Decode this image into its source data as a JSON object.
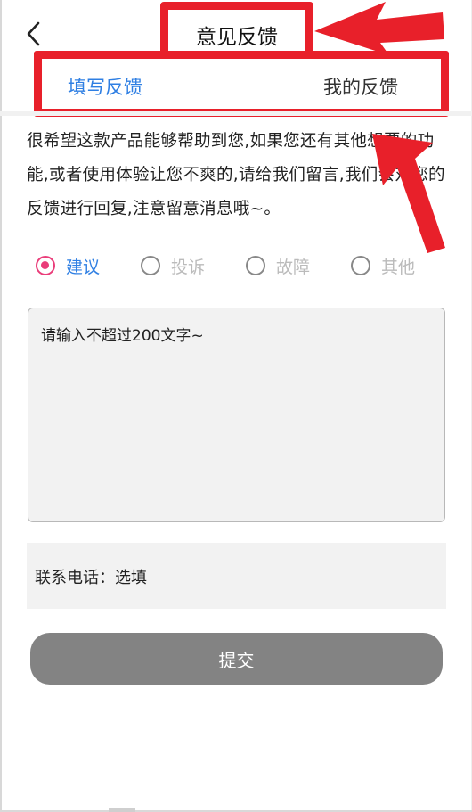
{
  "header": {
    "title": "意见反馈"
  },
  "tabs": [
    {
      "label": "填写反馈",
      "active": true
    },
    {
      "label": "我的反馈",
      "active": false
    }
  ],
  "intro": {
    "text": "很希望这款产品能够帮助到您,如果您还有其他想要的功能,或者使用体验让您不爽的,请给我们留言,我们会对您的反馈进行回复,注意留意消息哦~。"
  },
  "feedback_types": [
    {
      "label": "建议",
      "selected": true
    },
    {
      "label": "投诉",
      "selected": false
    },
    {
      "label": "故障",
      "selected": false
    },
    {
      "label": "其他",
      "selected": false
    }
  ],
  "feedback_input": {
    "placeholder": "请输入不超过200文字~"
  },
  "phone_input": {
    "label": "联系电话：选填"
  },
  "submit": {
    "label": "提交"
  },
  "colors": {
    "accent_blue": "#2f7fe3",
    "radio_pink": "#ea3d7a",
    "annotation_red": "#e8202a",
    "button_gray": "#838383"
  },
  "icons": [
    "back-arrow-icon",
    "radio-checked-icon",
    "radio-unchecked-icon"
  ]
}
